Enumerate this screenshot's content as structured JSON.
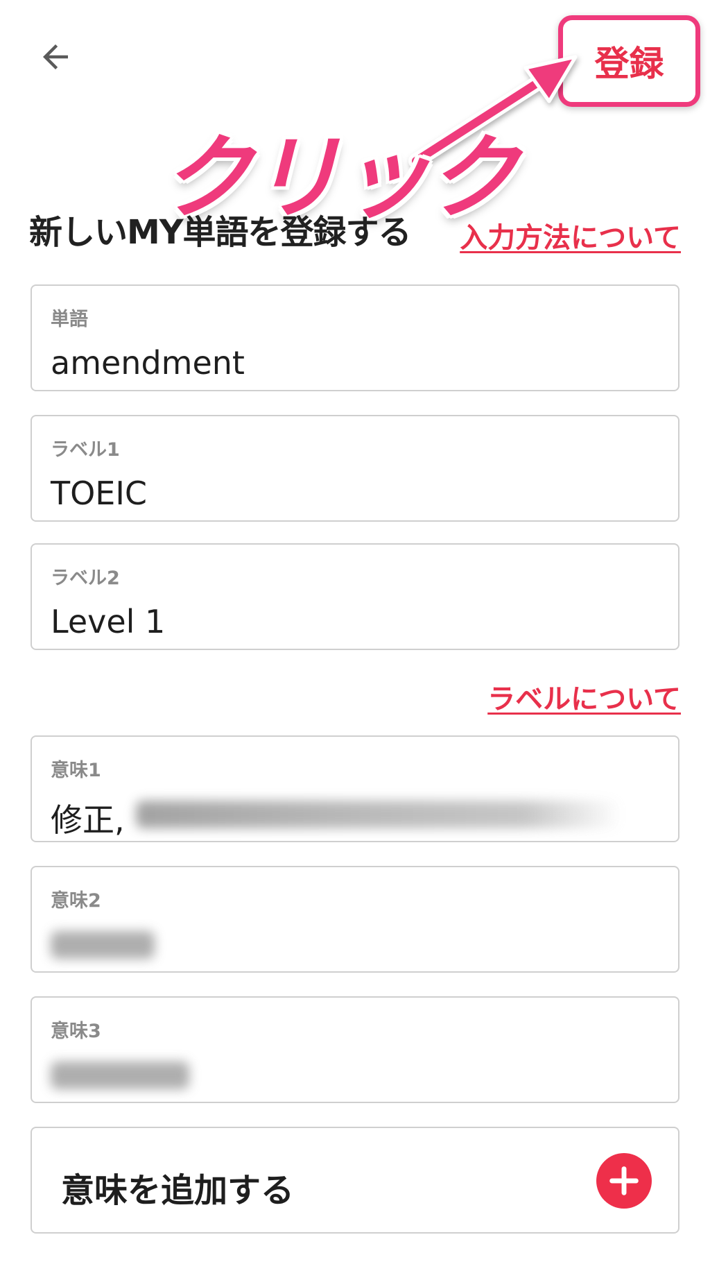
{
  "header": {
    "back_icon": "arrow-left-icon",
    "register_label": "登録",
    "annotation_text": "クリック"
  },
  "colors": {
    "accent": "#e8304b",
    "annotation_pink": "#ef3a7c",
    "field_border": "#cfcfcf",
    "label_gray": "#8a8a8a"
  },
  "main": {
    "title": "新しいMY単語を登録する",
    "input_method_link": "入力方法について",
    "label_about_link": "ラベルについて",
    "fields": {
      "word": {
        "label": "単語",
        "value": "amendment"
      },
      "label1": {
        "label": "ラベル1",
        "value": "TOEIC"
      },
      "label2": {
        "label": "ラベル2",
        "value": "Level 1"
      },
      "meaning1": {
        "label": "意味1",
        "value": "修正,"
      },
      "meaning2": {
        "label": "意味2",
        "value": ""
      },
      "meaning3": {
        "label": "意味3",
        "value": ""
      }
    },
    "add_meaning_label": "意味を追加する",
    "add_icon": "plus-circle-icon"
  }
}
